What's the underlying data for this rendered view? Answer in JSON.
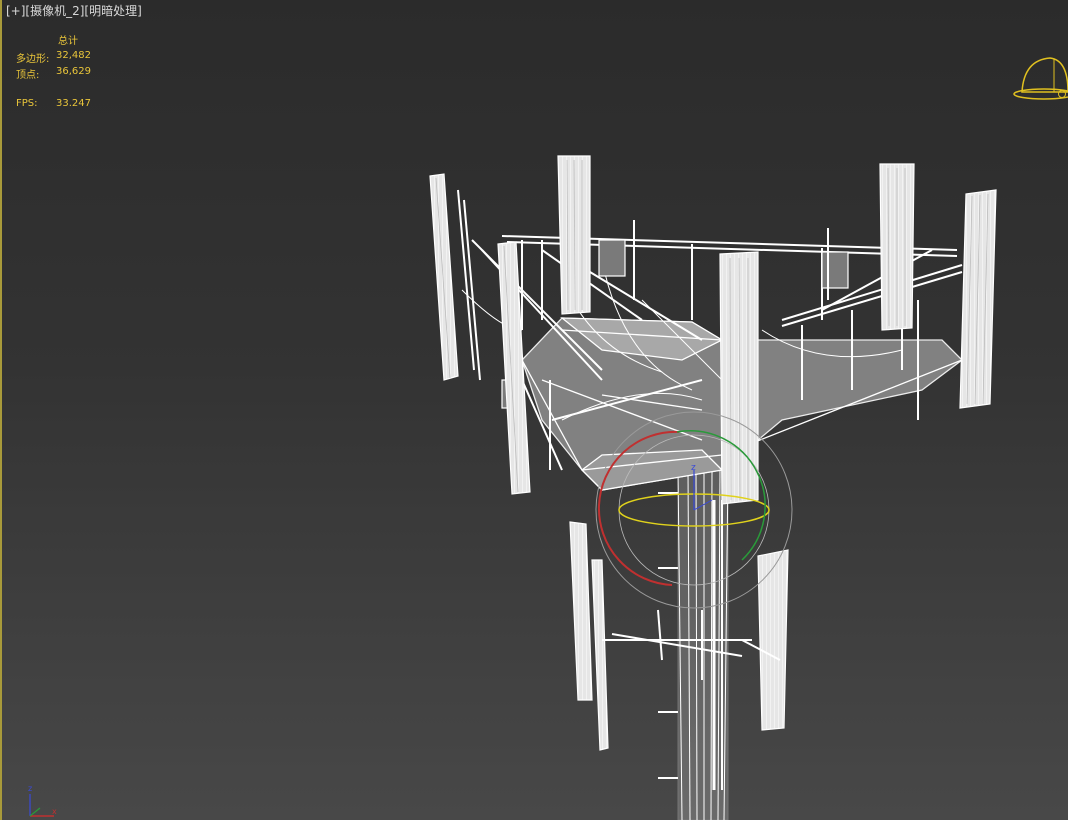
{
  "viewport": {
    "menu": {
      "plus": "[+]",
      "camera": "[摄像机_2]",
      "shading": "[明暗处理]"
    },
    "stats": {
      "header": "总计",
      "polygons_label": "多边形:",
      "polygons_value": "32,482",
      "vertices_label": "顶点:",
      "vertices_value": "36,629",
      "fps_label": "FPS:",
      "fps_value": "33.247"
    },
    "gizmo_axis_label": "z",
    "tripod": {
      "z": "z",
      "x": "x"
    }
  },
  "colors": {
    "stats_text": "#e9c53a",
    "wire": "#ffffff",
    "rotate_x": "#c03030",
    "rotate_y": "#2a9a3a",
    "rotate_z": "#e0d21c",
    "viewcube": "#e0c020"
  }
}
